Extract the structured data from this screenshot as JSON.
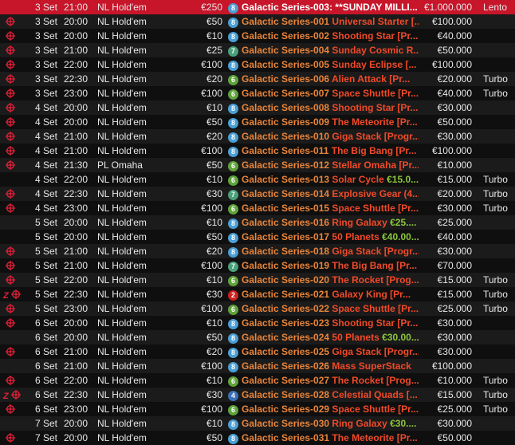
{
  "accent": "#c7152a",
  "rows": [
    {
      "date": "3 Set",
      "time": "21:00",
      "game": "NL Hold'em",
      "buyin": "€250",
      "badge": "8",
      "series": "Galactic Series-003:",
      "event": " **SUNDAY MILLI...",
      "gtd": "€1.000.000",
      "speed": "Lento",
      "icons": [],
      "selected": true
    },
    {
      "date": "3 Set",
      "time": "20:00",
      "game": "NL Hold'em",
      "buyin": "€50",
      "badge": "8",
      "series": "Galactic Series-001",
      "event": " Universal Starter [...",
      "gtd": "€100.000",
      "speed": "",
      "icons": [
        "target"
      ]
    },
    {
      "date": "3 Set",
      "time": "20:00",
      "game": "NL Hold'em",
      "buyin": "€10",
      "badge": "8",
      "series": "Galactic Series-002",
      "event": " Shooting Star [Pr...",
      "gtd": "€40.000",
      "speed": "",
      "icons": [
        "target"
      ]
    },
    {
      "date": "3 Set",
      "time": "21:00",
      "game": "NL Hold'em",
      "buyin": "€25",
      "badge": "7",
      "series": "Galactic Series-004",
      "event": " Sunday Cosmic R...",
      "gtd": "€50.000",
      "speed": "",
      "icons": [
        "target"
      ]
    },
    {
      "date": "3 Set",
      "time": "22:00",
      "game": "NL Hold'em",
      "buyin": "€100",
      "badge": "8",
      "series": "Galactic Series-005",
      "event": " Sunday Eclipse [...",
      "gtd": "€100.000",
      "speed": "",
      "icons": [
        "target"
      ]
    },
    {
      "date": "3 Set",
      "time": "22:30",
      "game": "NL Hold'em",
      "buyin": "€20",
      "badge": "6",
      "series": "Galactic Series-006",
      "event": " Alien Attack [Pr...",
      "gtd": "€20.000",
      "speed": "Turbo",
      "icons": [
        "target"
      ]
    },
    {
      "date": "3 Set",
      "time": "23:00",
      "game": "NL Hold'em",
      "buyin": "€100",
      "badge": "6",
      "series": "Galactic Series-007",
      "event": " Space Shuttle [Pr...",
      "gtd": "€40.000",
      "speed": "Turbo",
      "icons": [
        "target"
      ]
    },
    {
      "date": "4 Set",
      "time": "20:00",
      "game": "NL Hold'em",
      "buyin": "€10",
      "badge": "8",
      "series": "Galactic Series-008",
      "event": " Shooting Star [Pr...",
      "gtd": "€30.000",
      "speed": "",
      "icons": [
        "target"
      ]
    },
    {
      "date": "4 Set",
      "time": "20:00",
      "game": "NL Hold'em",
      "buyin": "€50",
      "badge": "8",
      "series": "Galactic Series-009",
      "event": " The Meteorite [Pr...",
      "gtd": "€50.000",
      "speed": "",
      "icons": [
        "target"
      ]
    },
    {
      "date": "4 Set",
      "time": "21:00",
      "game": "NL Hold'em",
      "buyin": "€20",
      "badge": "8",
      "series": "Galactic Series-010",
      "event": " Giga Stack [Progr...",
      "gtd": "€30.000",
      "speed": "",
      "icons": [
        "target"
      ]
    },
    {
      "date": "4 Set",
      "time": "21:00",
      "game": "NL Hold'em",
      "buyin": "€100",
      "badge": "8",
      "series": "Galactic Series-011",
      "event": " The Big Bang [Pr...",
      "gtd": "€100.000",
      "speed": "",
      "icons": [
        "target"
      ]
    },
    {
      "date": "4 Set",
      "time": "21:30",
      "game": "PL Omaha",
      "buyin": "€50",
      "badge": "6",
      "series": "Galactic Series-012",
      "event": " Stellar Omaha [Pr...",
      "gtd": "€10.000",
      "speed": "",
      "icons": [
        "target"
      ]
    },
    {
      "date": "4 Set",
      "time": "22:00",
      "game": "NL Hold'em",
      "buyin": "€10",
      "badge": "6",
      "series": "Galactic Series-013",
      "event": " Solar Cycle ",
      "event_green": "€15.0...",
      "gtd": "€15.000",
      "speed": "Turbo",
      "icons": []
    },
    {
      "date": "4 Set",
      "time": "22:30",
      "game": "NL Hold'em",
      "buyin": "€30",
      "badge": "7",
      "series": "Galactic Series-014",
      "event": " Explosive Gear (4...",
      "gtd": "€20.000",
      "speed": "Turbo",
      "icons": [
        "target"
      ]
    },
    {
      "date": "4 Set",
      "time": "23:00",
      "game": "NL Hold'em",
      "buyin": "€100",
      "badge": "6",
      "series": "Galactic Series-015",
      "event": " Space Shuttle [Pr...",
      "gtd": "€30.000",
      "speed": "Turbo",
      "icons": [
        "target"
      ]
    },
    {
      "date": "5 Set",
      "time": "20:00",
      "game": "NL Hold'em",
      "buyin": "€10",
      "badge": "8",
      "series": "Galactic Series-016",
      "event": " Ring Galaxy ",
      "event_green": "€25....",
      "gtd": "€25.000",
      "speed": "",
      "icons": []
    },
    {
      "date": "5 Set",
      "time": "20:00",
      "game": "NL Hold'em",
      "buyin": "€50",
      "badge": "8",
      "series": "Galactic Series-017",
      "event": " 50 Planets ",
      "event_green": "€40.00...",
      "gtd": "€40.000",
      "speed": "",
      "icons": []
    },
    {
      "date": "5 Set",
      "time": "21:00",
      "game": "NL Hold'em",
      "buyin": "€20",
      "badge": "8",
      "series": "Galactic Series-018",
      "event": " Giga Stack [Progr...",
      "gtd": "€30.000",
      "speed": "",
      "icons": [
        "target"
      ]
    },
    {
      "date": "5 Set",
      "time": "21:00",
      "game": "NL Hold'em",
      "buyin": "€100",
      "badge": "7",
      "series": "Galactic Series-019",
      "event": " The Big Bang [Pr...",
      "gtd": "€70.000",
      "speed": "",
      "icons": [
        "target"
      ]
    },
    {
      "date": "5 Set",
      "time": "22:00",
      "game": "NL Hold'em",
      "buyin": "€10",
      "badge": "6",
      "series": "Galactic Series-020",
      "event": " The Rocket [Prog...",
      "gtd": "€15.000",
      "speed": "Turbo",
      "icons": [
        "target"
      ]
    },
    {
      "date": "5 Set",
      "time": "22:30",
      "game": "NL Hold'em",
      "buyin": "€30",
      "badge": "2",
      "series": "Galactic Series-021",
      "event": " Galaxy King [Pr...",
      "gtd": "€15.000",
      "speed": "Turbo",
      "icons": [
        "z",
        "target"
      ]
    },
    {
      "date": "5 Set",
      "time": "23:00",
      "game": "NL Hold'em",
      "buyin": "€100",
      "badge": "6",
      "series": "Galactic Series-022",
      "event": " Space Shuttle [Pr...",
      "gtd": "€25.000",
      "speed": "Turbo",
      "icons": [
        "target"
      ]
    },
    {
      "date": "6 Set",
      "time": "20:00",
      "game": "NL Hold'em",
      "buyin": "€10",
      "badge": "8",
      "series": "Galactic Series-023",
      "event": " Shooting Star [Pr...",
      "gtd": "€30.000",
      "speed": "",
      "icons": [
        "target"
      ]
    },
    {
      "date": "6 Set",
      "time": "20:00",
      "game": "NL Hold'em",
      "buyin": "€50",
      "badge": "8",
      "series": "Galactic Series-024",
      "event": " 50 Planets ",
      "event_green": "€30.00...",
      "gtd": "€30.000",
      "speed": "",
      "icons": []
    },
    {
      "date": "6 Set",
      "time": "21:00",
      "game": "NL Hold'em",
      "buyin": "€20",
      "badge": "8",
      "series": "Galactic Series-025",
      "event": " Giga Stack [Progr...",
      "gtd": "€30.000",
      "speed": "",
      "icons": [
        "target"
      ]
    },
    {
      "date": "6 Set",
      "time": "21:00",
      "game": "NL Hold'em",
      "buyin": "€100",
      "badge": "8",
      "series": "Galactic Series-026",
      "event": " Mass SuperStack",
      "gtd": "€100.000",
      "speed": "",
      "icons": []
    },
    {
      "date": "6 Set",
      "time": "22:00",
      "game": "NL Hold'em",
      "buyin": "€10",
      "badge": "6",
      "series": "Galactic Series-027",
      "event": " The Rocket [Prog...",
      "gtd": "€10.000",
      "speed": "Turbo",
      "icons": [
        "target"
      ]
    },
    {
      "date": "6 Set",
      "time": "22:30",
      "game": "NL Hold'em",
      "buyin": "€30",
      "badge": "4",
      "series": "Galactic Series-028",
      "event": " Celestial Quads [...",
      "gtd": "€15.000",
      "speed": "Turbo",
      "icons": [
        "z",
        "target"
      ]
    },
    {
      "date": "6 Set",
      "time": "23:00",
      "game": "NL Hold'em",
      "buyin": "€100",
      "badge": "6",
      "series": "Galactic Series-029",
      "event": " Space Shuttle [Pr...",
      "gtd": "€25.000",
      "speed": "Turbo",
      "icons": [
        "target"
      ]
    },
    {
      "date": "7 Set",
      "time": "20:00",
      "game": "NL Hold'em",
      "buyin": "€10",
      "badge": "8",
      "series": "Galactic Series-030",
      "event": " Ring Galaxy ",
      "event_green": "€30....",
      "gtd": "€30.000",
      "speed": "",
      "icons": []
    },
    {
      "date": "7 Set",
      "time": "20:00",
      "game": "NL Hold'em",
      "buyin": "€50",
      "badge": "8",
      "series": "Galactic Series-031",
      "event": " The Meteorite [Pr...",
      "gtd": "€50.000",
      "speed": "",
      "icons": [
        "target"
      ]
    }
  ]
}
